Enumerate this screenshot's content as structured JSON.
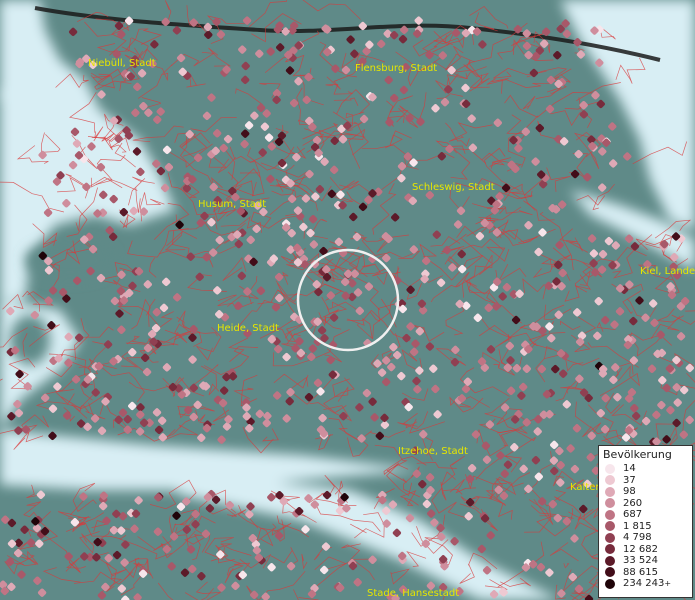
{
  "map": {
    "places": [
      {
        "name": "Niebüll, Stadt"
      },
      {
        "name": "Flensburg, Stadt"
      },
      {
        "name": "Schleswig, Stadt"
      },
      {
        "name": "Husum, Stadt"
      },
      {
        "name": "Kiel, Landes"
      },
      {
        "name": "Heide, Stadt"
      },
      {
        "name": "Itzehoe, Stadt"
      },
      {
        "name": "Kalten"
      },
      {
        "name": "Stade, Hansestadt"
      }
    ],
    "colors": {
      "water": "#d8eef4",
      "land": "#5f8a88",
      "boundary": "#d9383a",
      "label": "#e6e600",
      "border_line": "#1a1a1a"
    }
  },
  "legend": {
    "title": "Bevölkerung",
    "entries": [
      {
        "label": "14",
        "color": "#f7e6ec"
      },
      {
        "label": "37",
        "color": "#eec9d2"
      },
      {
        "label": "98",
        "color": "#dfa9b6"
      },
      {
        "label": "260",
        "color": "#cf8e9d"
      },
      {
        "label": "687",
        "color": "#bf7484"
      },
      {
        "label": "1 815",
        "color": "#a85869"
      },
      {
        "label": "4 798",
        "color": "#904052"
      },
      {
        "label": "12 682",
        "color": "#772b3c"
      },
      {
        "label": "33 524",
        "color": "#5c1a29"
      },
      {
        "label": "88 615",
        "color": "#420d19"
      },
      {
        "label": "234 243",
        "color": "#1f0409"
      }
    ],
    "plus": "+"
  }
}
